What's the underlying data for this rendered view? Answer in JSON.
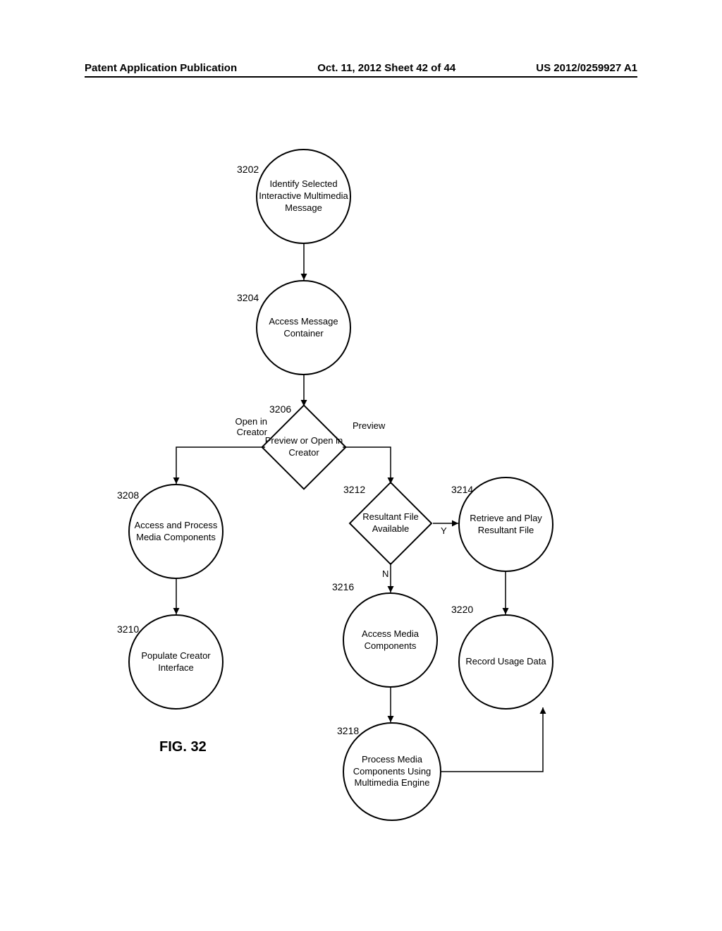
{
  "header": {
    "left": "Patent Application Publication",
    "center": "Oct. 11, 2012  Sheet 42 of 44",
    "right": "US 2012/0259927 A1"
  },
  "figure_label": "FIG. 32",
  "nodes": {
    "n3202": {
      "ref": "3202",
      "text": "Identify Selected Interactive Multimedia Message"
    },
    "n3204": {
      "ref": "3204",
      "text": "Access Message Container"
    },
    "n3206": {
      "ref": "3206",
      "text": "Preview or Open in Creator"
    },
    "n3208": {
      "ref": "3208",
      "text": "Access and Process Media Components"
    },
    "n3210": {
      "ref": "3210",
      "text": "Populate Creator Interface"
    },
    "n3212": {
      "ref": "3212",
      "text": "Resultant File Available"
    },
    "n3214": {
      "ref": "3214",
      "text": "Retrieve and Play Resultant File"
    },
    "n3216": {
      "ref": "3216",
      "text": "Access Media Components"
    },
    "n3218": {
      "ref": "3218",
      "text": "Process Media Components Using Multimedia Engine"
    },
    "n3220": {
      "ref": "3220",
      "text": "Record Usage Data"
    }
  },
  "edge_labels": {
    "open_in_creator": "Open in Creator",
    "preview": "Preview",
    "y": "Y",
    "n": "N"
  }
}
